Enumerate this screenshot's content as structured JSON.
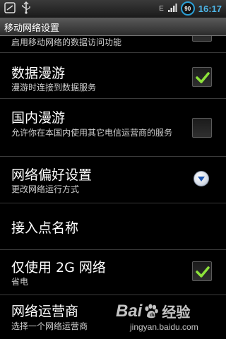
{
  "status_bar": {
    "time": "16:17",
    "battery_level": "90",
    "network_type": "E",
    "icons": [
      "notification-icon",
      "usb-icon",
      "signal-icon",
      "battery-icon"
    ]
  },
  "title_bar": {
    "title": "移动网络设置"
  },
  "settings": {
    "partial_summary": "启用移动网络的数据访问功能",
    "items": [
      {
        "title": "数据漫游",
        "summary": "漫游时连接到数据服务",
        "checked": true
      },
      {
        "title": "国内漫游",
        "summary": "允许你在本国内使用其它电信运营商的服务",
        "checked": false
      },
      {
        "title": "网络偏好设置",
        "summary": "更改网络运行方式"
      },
      {
        "title": "接入点名称"
      },
      {
        "title": "仅使用 2G 网络",
        "summary": "省电",
        "checked": true
      },
      {
        "title": "网络运营商",
        "summary": "选择一个网络运营商"
      }
    ]
  },
  "watermark": {
    "brand_latin": "Bai",
    "brand_cn": "经验",
    "url": "jingyan.baidu.com"
  },
  "colors": {
    "accent": "#4db6e8",
    "check": "#8de33a",
    "background": "#000000"
  }
}
